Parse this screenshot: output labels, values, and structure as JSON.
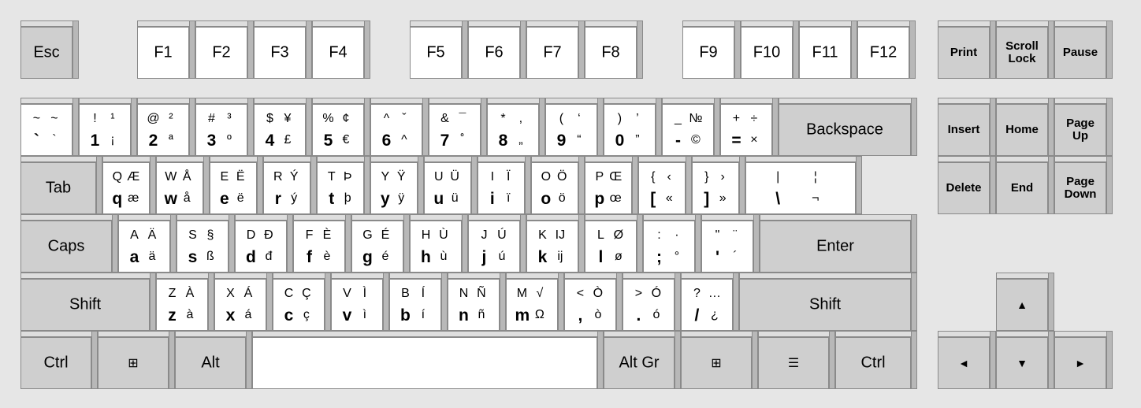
{
  "colors": {
    "background": "#e6e6e6",
    "key_white": "#ffffff",
    "key_gray": "#cfcfcf",
    "side": "#b8b8b8",
    "edge": "#8a8a8a"
  },
  "function_row": {
    "esc": "Esc",
    "f": [
      "F1",
      "F2",
      "F3",
      "F4",
      "F5",
      "F6",
      "F7",
      "F8",
      "F9",
      "F10",
      "F11",
      "F12"
    ],
    "print": "Print",
    "scroll": "Scroll\nLock",
    "pause": "Pause"
  },
  "number_row": [
    [
      "~",
      "~",
      "`",
      "`"
    ],
    [
      "!",
      "¹",
      "1",
      "¡"
    ],
    [
      "@",
      "²",
      "2",
      "ª"
    ],
    [
      "#",
      "³",
      "3",
      "º"
    ],
    [
      "$",
      "¥",
      "4",
      "£"
    ],
    [
      "%",
      "¢",
      "5",
      "€"
    ],
    [
      "^",
      "ˇ",
      "6",
      "^"
    ],
    [
      "&",
      "¯",
      "7",
      "˚"
    ],
    [
      "*",
      ",",
      "8",
      "„"
    ],
    [
      "(",
      "‘",
      "9",
      "“"
    ],
    [
      ")",
      "’",
      "0",
      "”"
    ],
    [
      "_",
      "№",
      "-",
      "©"
    ],
    [
      "+",
      "÷",
      "=",
      "×"
    ]
  ],
  "backspace": "Backspace",
  "qwerty_row": [
    [
      "Q",
      "Æ",
      "q",
      "æ"
    ],
    [
      "W",
      "Å",
      "w",
      "å"
    ],
    [
      "E",
      "Ë",
      "e",
      "ë"
    ],
    [
      "R",
      "Ý",
      "r",
      "ý"
    ],
    [
      "T",
      "Þ",
      "t",
      "þ"
    ],
    [
      "Y",
      "Ÿ",
      "y",
      "ÿ"
    ],
    [
      "U",
      "Ü",
      "u",
      "ü"
    ],
    [
      "I",
      "Ï",
      "i",
      "ï"
    ],
    [
      "O",
      "Ö",
      "o",
      "ö"
    ],
    [
      "P",
      "Œ",
      "p",
      "œ"
    ],
    [
      "{",
      "‹",
      "[",
      "«"
    ],
    [
      "}",
      "›",
      "]",
      "»"
    ],
    [
      "|",
      "¦",
      "\\",
      "¬"
    ]
  ],
  "tab": "Tab",
  "home_row": [
    [
      "A",
      "Ä",
      "a",
      "ä"
    ],
    [
      "S",
      "§",
      "s",
      "ß"
    ],
    [
      "D",
      "Đ",
      "d",
      "đ"
    ],
    [
      "F",
      "È",
      "f",
      "è"
    ],
    [
      "G",
      "É",
      "g",
      "é"
    ],
    [
      "H",
      "Ù",
      "h",
      "ù"
    ],
    [
      "J",
      "Ú",
      "j",
      "ú"
    ],
    [
      "K",
      "IJ",
      "k",
      "ij"
    ],
    [
      "L",
      "Ø",
      "l",
      "ø"
    ],
    [
      ":",
      "·",
      ";",
      "°"
    ],
    [
      "\"",
      "¨",
      "'",
      "´"
    ]
  ],
  "caps": "Caps",
  "enter": "Enter",
  "shift_row": [
    [
      "Z",
      "À",
      "z",
      "à"
    ],
    [
      "X",
      "Á",
      "x",
      "á"
    ],
    [
      "C",
      "Ç",
      "c",
      "ç"
    ],
    [
      "V",
      "Ì",
      "v",
      "ì"
    ],
    [
      "B",
      "Í",
      "b",
      "í"
    ],
    [
      "N",
      "Ñ",
      "n",
      "ñ"
    ],
    [
      "M",
      "√",
      "m",
      "Ω"
    ],
    [
      "<",
      "Ò",
      ",",
      "ò"
    ],
    [
      ">",
      "Ó",
      ".",
      "ó"
    ],
    [
      "?",
      "…",
      "/",
      "¿"
    ]
  ],
  "shift": "Shift",
  "bottom": {
    "ctrl": "Ctrl",
    "alt": "Alt",
    "altgr": "Alt Gr"
  },
  "nav": {
    "insert": "Insert",
    "home": "Home",
    "pageup": "Page\nUp",
    "delete": "Delete",
    "end": "End",
    "pagedown": "Page\nDown"
  },
  "arrows": {
    "up": "▲",
    "down": "▼",
    "left": "◄",
    "right": "►"
  },
  "icons": {
    "windows": "windows-icon",
    "menu": "context-menu-icon"
  }
}
